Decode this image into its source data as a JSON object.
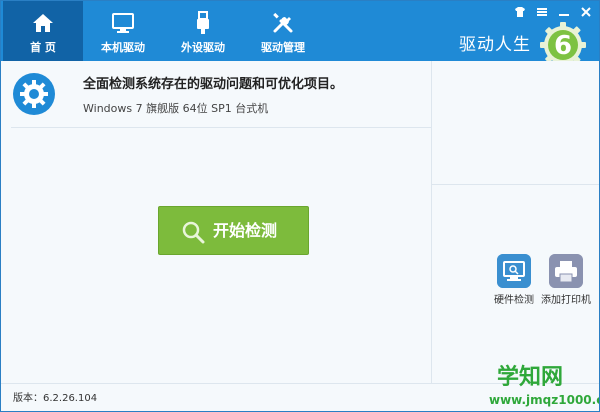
{
  "nav": {
    "tabs": [
      {
        "label": "首 页",
        "icon": "home-icon",
        "active": true
      },
      {
        "label": "本机驱动",
        "icon": "monitor-icon",
        "active": false
      },
      {
        "label": "外设驱动",
        "icon": "usb-icon",
        "active": false
      },
      {
        "label": "驱动管理",
        "icon": "tools-icon",
        "active": false
      }
    ]
  },
  "window_controls": [
    "skin-icon",
    "menu-icon",
    "minimize-icon",
    "close-icon"
  ],
  "brand": {
    "title": "驱动人生",
    "logo_glyph": "6"
  },
  "info": {
    "headline": "全面检测系统存在的驱动问题和可优化项目。",
    "system": "Windows 7 旗舰版  64位 SP1 台式机"
  },
  "scan_button": {
    "label": "开始检测"
  },
  "tools": [
    {
      "label": "硬件检测",
      "icon": "hardware-check-icon"
    },
    {
      "label": "添加打印机",
      "icon": "printer-icon"
    }
  ],
  "status": {
    "version": "版本：6.2.26.104"
  },
  "watermark": {
    "main": "学知网",
    "url": "www.jmqz1000.com"
  },
  "colors": {
    "topbar": "#1f8ad6",
    "active_tab": "#1163a6",
    "scan_button": "#7dbb3c",
    "logo_green": "#7dc242",
    "watermark": "#2fa83a"
  }
}
